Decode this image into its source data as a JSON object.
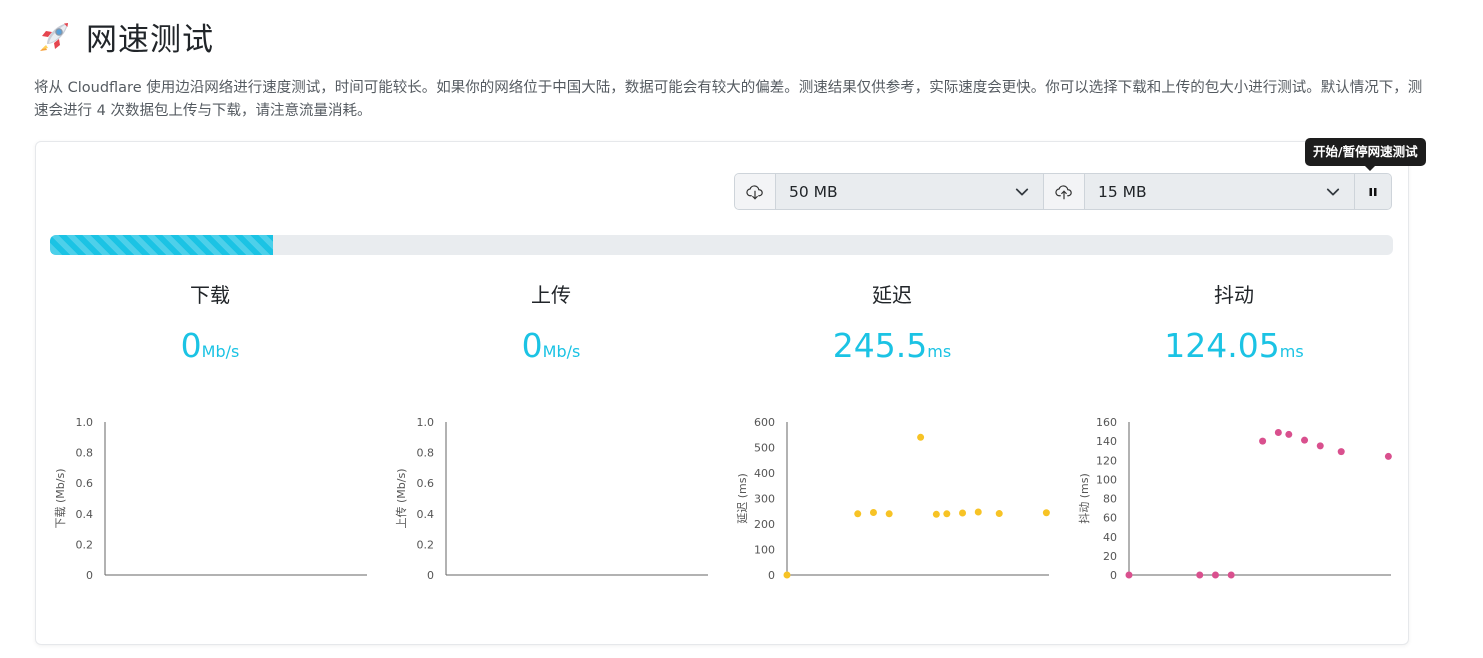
{
  "header": {
    "title": "网速测试",
    "icon": "rocket-icon"
  },
  "description": "将从 Cloudflare 使用边沿网络进行速度测试，时间可能较长。如果你的网络位于中国大陆，数据可能会有较大的偏差。测速结果仅供参考，实际速度会更快。你可以选择下载和上传的包大小进行测试。默认情况下，测速会进行 4 次数据包上传与下载，请注意流量消耗。",
  "controls": {
    "download_icon": "cloud-download-icon",
    "download_size": "50 MB",
    "upload_icon": "cloud-upload-icon",
    "upload_size": "15 MB",
    "toggle_icon": "pause-icon",
    "tooltip": "开始/暂停网速测试"
  },
  "progress": {
    "fraction": 0.166
  },
  "metrics": {
    "download": {
      "label": "下载",
      "value": "0",
      "unit": "Mb/s"
    },
    "upload": {
      "label": "上传",
      "value": "0",
      "unit": "Mb/s"
    },
    "latency": {
      "label": "延迟",
      "value": "245.5",
      "unit": "ms"
    },
    "jitter": {
      "label": "抖动",
      "value": "124.05",
      "unit": "ms"
    }
  },
  "colors": {
    "accent": "#1bc3e4",
    "latency_points": "#f7c325",
    "jitter_points": "#d9508e"
  },
  "chart_data": [
    {
      "type": "scatter",
      "ylabel": "下载 (Mb/s)",
      "ylim": [
        0,
        1
      ],
      "yticks": [
        "0",
        "0.2",
        "0.4",
        "0.6",
        "0.8",
        "1.0"
      ],
      "x": [],
      "values": []
    },
    {
      "type": "scatter",
      "ylabel": "上传 (Mb/s)",
      "ylim": [
        0,
        1
      ],
      "yticks": [
        "0",
        "0.2",
        "0.4",
        "0.6",
        "0.8",
        "1.0"
      ],
      "x": [],
      "values": []
    },
    {
      "type": "scatter",
      "ylabel": "延迟 (ms)",
      "ylim": [
        0,
        600
      ],
      "yticks": [
        "0",
        "100",
        "200",
        "300",
        "400",
        "500",
        "600"
      ],
      "x": [
        0,
        27,
        33,
        39,
        51,
        57,
        61,
        67,
        73,
        81,
        99
      ],
      "xlim": [
        0,
        100
      ],
      "values": [
        0,
        240,
        245,
        240,
        540,
        238,
        240,
        243,
        247,
        241,
        244
      ]
    },
    {
      "type": "scatter",
      "ylabel": "抖动 (ms)",
      "ylim": [
        0,
        160
      ],
      "yticks": [
        "0",
        "20",
        "40",
        "60",
        "80",
        "100",
        "120",
        "140",
        "160"
      ],
      "x": [
        0,
        27,
        33,
        39,
        51,
        57,
        61,
        67,
        73,
        81,
        99
      ],
      "xlim": [
        0,
        100
      ],
      "values": [
        0,
        0,
        0,
        0,
        140,
        149,
        147,
        141,
        135,
        129,
        124
      ]
    }
  ]
}
